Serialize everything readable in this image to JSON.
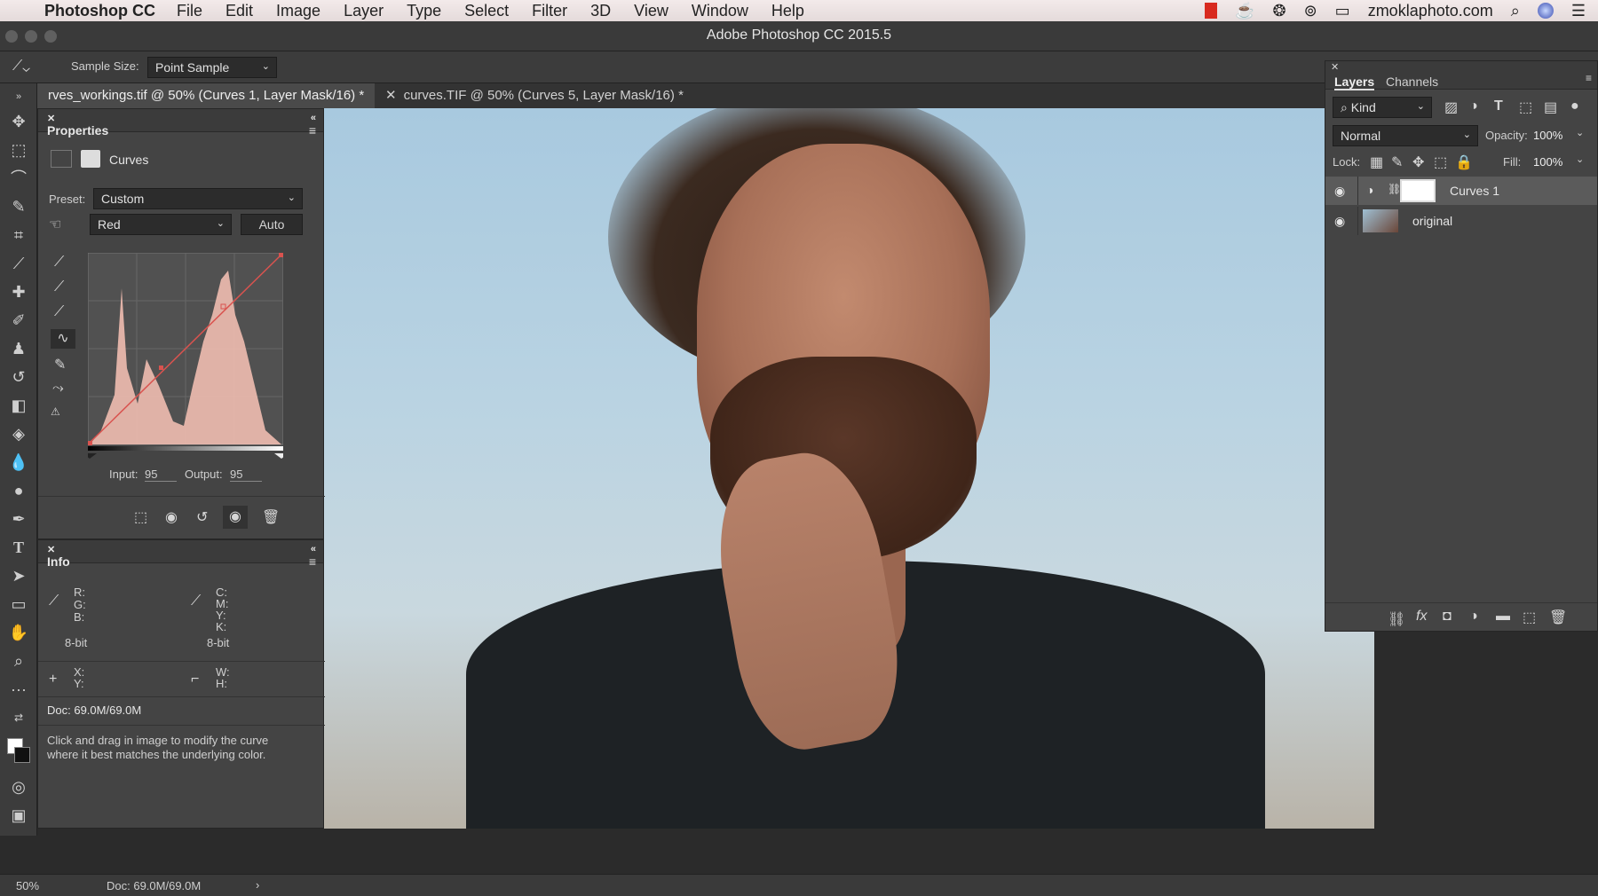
{
  "menubar": {
    "app": "Photoshop CC",
    "items": [
      "File",
      "Edit",
      "Image",
      "Layer",
      "Type",
      "Select",
      "Filter",
      "3D",
      "View",
      "Window",
      "Help"
    ],
    "website": "zmoklaphoto.com"
  },
  "window": {
    "title": "Adobe Photoshop CC 2015.5"
  },
  "options": {
    "sample_size_label": "Sample Size:",
    "sample_size_value": "Point Sample"
  },
  "tabs": [
    {
      "label": "rves_workings.tif @ 50% (Curves 1, Layer Mask/16) *",
      "active": true
    },
    {
      "label": "curves.TIF @ 50% (Curves 5, Layer Mask/16) *",
      "active": false
    }
  ],
  "properties": {
    "title": "Properties",
    "type": "Curves",
    "preset_label": "Preset:",
    "preset_value": "Custom",
    "channel_value": "Red",
    "auto_label": "Auto",
    "input_label": "Input:",
    "input_value": "95",
    "output_label": "Output:",
    "output_value": "95"
  },
  "info": {
    "title": "Info",
    "rgb_labels": [
      "R:",
      "G:",
      "B:"
    ],
    "cmyk_labels": [
      "C:",
      "M:",
      "Y:",
      "K:"
    ],
    "bitdepth_left": "8-bit",
    "bitdepth_right": "8-bit",
    "xy_labels": [
      "X:",
      "Y:"
    ],
    "wh_labels": [
      "W:",
      "H:"
    ],
    "doc": "Doc: 69.0M/69.0M",
    "hint": "Click and drag in image to modify the curve where it best matches the underlying color."
  },
  "layers": {
    "tabs": [
      "Layers",
      "Channels"
    ],
    "kind_label": "Kind",
    "blend_mode": "Normal",
    "opacity_label": "Opacity:",
    "opacity_value": "100%",
    "lock_label": "Lock:",
    "fill_label": "Fill:",
    "fill_value": "100%",
    "rows": [
      {
        "name": "Curves 1"
      },
      {
        "name": "original"
      }
    ]
  },
  "status": {
    "zoom": "50%",
    "doc": "Doc: 69.0M/69.0M"
  },
  "colors": {
    "accent": "#4a4a4a",
    "panel": "#444444",
    "curve": "#e05050"
  }
}
